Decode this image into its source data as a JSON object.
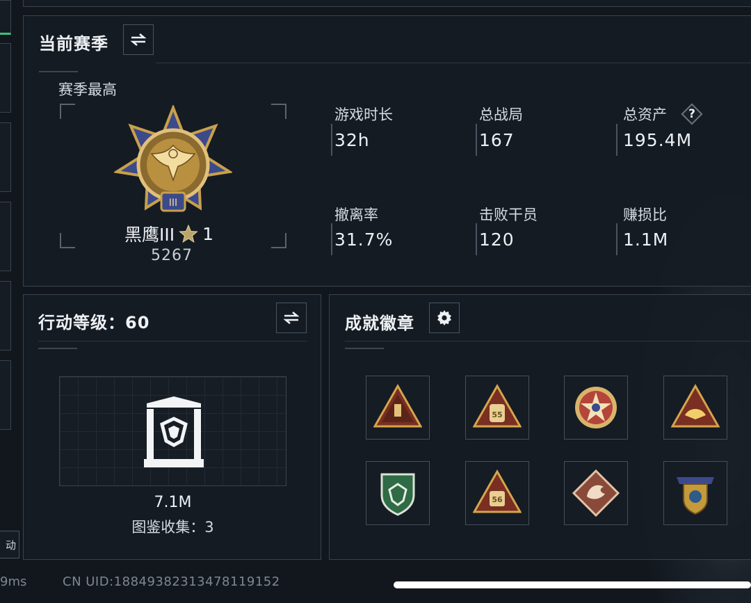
{
  "season": {
    "title": "当前赛季",
    "peak_label": "赛季最高",
    "rank_name": "黑鹰III",
    "rank_stars": "1",
    "rank_score": "5267",
    "rank_tier_numeral": "III",
    "stats": [
      {
        "label": "游戏时长",
        "value": "32h"
      },
      {
        "label": "总战局",
        "value": "167"
      },
      {
        "label": "总资产",
        "value": "195.4M"
      },
      {
        "label": "撤离率",
        "value": "31.7%"
      },
      {
        "label": "击败干员",
        "value": "120"
      },
      {
        "label": "赚损比",
        "value": "1.1M"
      }
    ],
    "help_symbol": "?"
  },
  "action_level": {
    "title": "行动等级：60",
    "value": "7.1M",
    "collection_label": "图鉴收集：3"
  },
  "achievements": {
    "title": "成就徽章",
    "badges": [
      {
        "icon": "triangle-badge-brown-icon",
        "color": "#b8862e"
      },
      {
        "icon": "triangle-badge-55-icon",
        "label": "55",
        "color": "#c09448"
      },
      {
        "icon": "star-roundel-badge-icon",
        "color": "#b5453a"
      },
      {
        "icon": "triangle-badge-gold-icon",
        "color": "#d2a640"
      },
      {
        "icon": "green-shield-badge-icon",
        "color": "#2f6b45"
      },
      {
        "icon": "triangle-badge-56-icon",
        "label": "56",
        "color": "#c09448"
      },
      {
        "icon": "dragon-diamond-badge-icon",
        "color": "#8a4a3a"
      },
      {
        "icon": "winged-shield-badge-icon",
        "color": "#c49a3a"
      }
    ]
  },
  "footer": {
    "ping": "9ms",
    "uid": "CN UID:18849382313478119152",
    "side_tab_label": "动"
  },
  "colors": {
    "background": "#12171e",
    "panel_border": "#3a4350",
    "accent_green": "#3fbf7f",
    "medal_gold": "#c9a04a",
    "medal_blue": "#3c4a8c"
  }
}
